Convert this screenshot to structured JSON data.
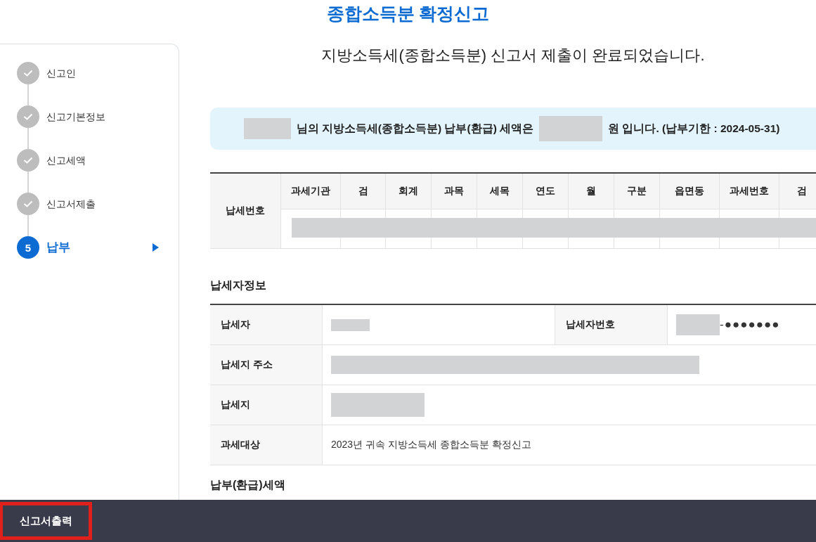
{
  "page_title": "종합소득분 확정신고",
  "sidebar": {
    "steps": [
      {
        "label": "신고인",
        "kind": "done"
      },
      {
        "label": "신고기본정보",
        "kind": "done"
      },
      {
        "label": "신고세액",
        "kind": "done"
      },
      {
        "label": "신고서제출",
        "kind": "done"
      },
      {
        "label": "납부",
        "number": "5",
        "kind": "current"
      }
    ]
  },
  "message": "지방소득세(종합소득분) 신고서 제출이 완료되었습니다.",
  "notice": {
    "parts": [
      {
        "kind": "redacted"
      },
      {
        "kind": "text",
        "text": "님의 지방소득세(종합소득분) 납부(환급) 세액은"
      },
      {
        "kind": "redacted"
      },
      {
        "kind": "text",
        "text": "원 입니다. (납부기한 : 2024-05-31)"
      }
    ]
  },
  "tax_number": {
    "label": "납세번호",
    "columns": [
      "과세기관",
      "검",
      "회계",
      "과목",
      "세목",
      "연도",
      "월",
      "구분",
      "읍면동",
      "과세번호",
      "검"
    ]
  },
  "taxpayer_info": {
    "title": "납세자정보",
    "rows": [
      {
        "fields": [
          {
            "label": "납세자",
            "redacted": true
          },
          {
            "label": "납세자번호",
            "redacted": true,
            "suffix": "-●●●●●●●"
          }
        ]
      },
      {
        "fields": [
          {
            "label": "납세지 주소",
            "redacted": true
          }
        ]
      },
      {
        "fields": [
          {
            "label": "납세지",
            "redacted": true
          }
        ]
      },
      {
        "fields": [
          {
            "label": "과세대상",
            "value": "2023년 귀속 지방소득세 종합소득분 확정신고"
          }
        ]
      }
    ]
  },
  "next_section": {
    "title": "납부(환급)세액"
  },
  "footer": {
    "buttons": [
      {
        "label": "신고서출력",
        "highlighted": true
      }
    ]
  }
}
